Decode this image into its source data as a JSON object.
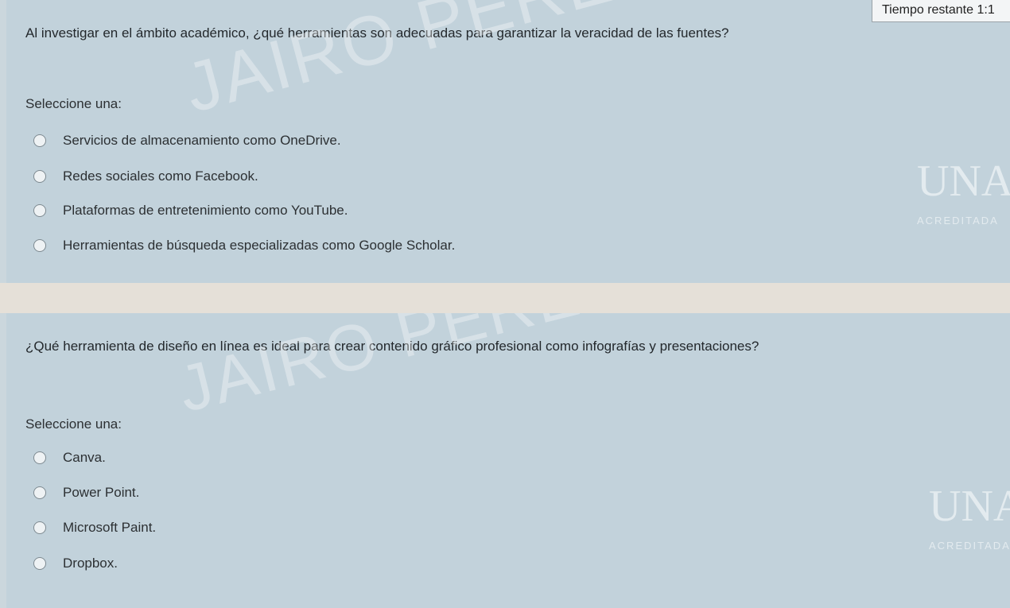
{
  "timer": {
    "label": "Tiempo restante",
    "value": "1:1"
  },
  "questions": [
    {
      "text": "Al investigar en el ámbito académico, ¿qué herramientas son adecuadas para garantizar la veracidad de las fuentes?",
      "prompt": "Seleccione una:",
      "options": [
        "Servicios de almacenamiento como OneDrive.",
        "Redes sociales como Facebook.",
        "Plataformas de entretenimiento como YouTube.",
        "Herramientas de búsqueda especializadas como Google Scholar."
      ]
    },
    {
      "text": "¿Qué herramienta de diseño en línea es ideal para crear contenido gráfico profesional como infografías y presentaciones?",
      "prompt": "Seleccione una:",
      "options": [
        "Canva.",
        "Power Point.",
        "Microsoft Paint.",
        "Dropbox."
      ]
    }
  ],
  "watermark": {
    "text": "JAIRO PEREA CASTANO"
  },
  "logo": {
    "letters": "UNAD",
    "acreditada": "ACREDITADA"
  }
}
